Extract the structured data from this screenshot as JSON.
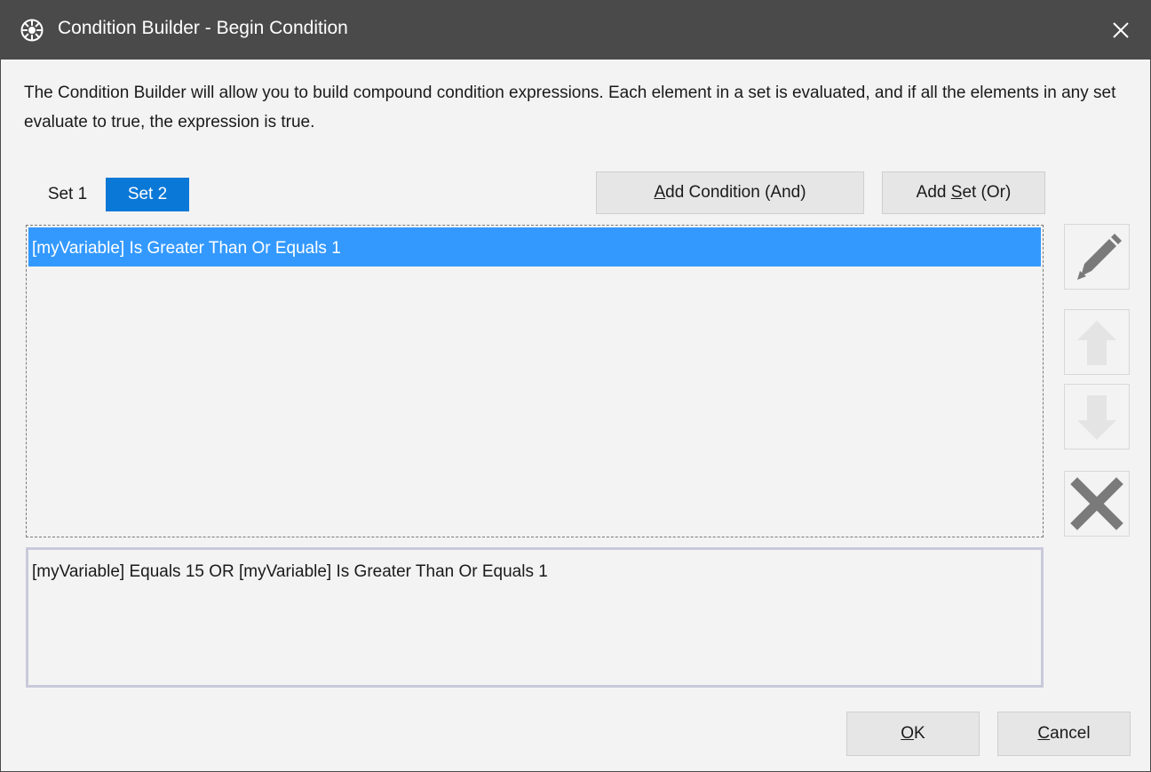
{
  "window": {
    "title": "Condition Builder - Begin Condition"
  },
  "description": "The Condition Builder will allow you to build compound condition expressions.  Each element in a set is evaluated, and if all the elements in any set evaluate to true, the expression is true.",
  "tabs": [
    {
      "label": "Set 1",
      "selected": false
    },
    {
      "label": "Set 2",
      "selected": true
    }
  ],
  "toolbar": {
    "add_condition": {
      "pre": "",
      "key": "A",
      "post": "dd Condition (And)"
    },
    "add_set": {
      "pre": "Add ",
      "key": "S",
      "post": "et (Or)"
    }
  },
  "conditions": [
    {
      "text": "[myVariable] Is Greater Than Or Equals 1",
      "selected": true
    }
  ],
  "side_buttons": {
    "edit": {
      "icon": "pencil-icon",
      "enabled": true
    },
    "move_up": {
      "icon": "arrow-up-icon",
      "enabled": false
    },
    "move_down": {
      "icon": "arrow-down-icon",
      "enabled": false
    },
    "delete": {
      "icon": "x-icon",
      "enabled": true
    }
  },
  "expression": "[myVariable] Equals 15 OR [myVariable] Is Greater Than Or Equals 1",
  "footer": {
    "ok": {
      "key": "O",
      "post": "K"
    },
    "cancel": {
      "key": "C",
      "post": "ancel"
    }
  },
  "colors": {
    "titlebar": "#4a4a4a",
    "accent": "#0a78d7",
    "selection": "#3399ff",
    "background": "#f3f3f3"
  }
}
